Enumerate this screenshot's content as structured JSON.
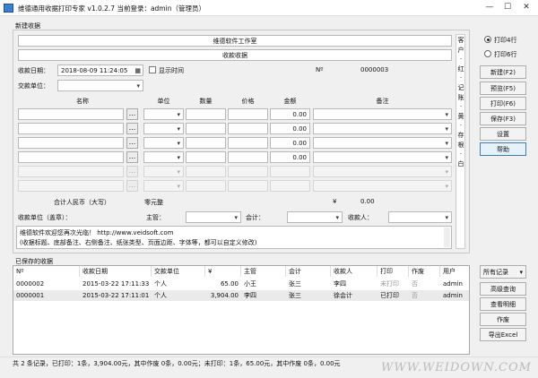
{
  "window": {
    "title": "维德通用收据打印专家 v1.0.2.7    当前登录：admin（管理员）",
    "min": "—",
    "max": "☐",
    "close": "✕"
  },
  "new_receipt": {
    "section_title": "新建收据",
    "company": "维德软件工作室",
    "doc_title": "收款收据",
    "date_label": "收款日期：",
    "date_value": "2018-08-09 11:24:05",
    "show_time_label": "显示时间",
    "no_label": "Nº",
    "no_value": "0000003",
    "payer_label": "交款单位：",
    "columns": {
      "name": "名称",
      "unit": "单位",
      "qty": "数量",
      "price": "价格",
      "amount": "金额",
      "note": "备注"
    },
    "rows": [
      {
        "amount": "0.00",
        "enabled": true
      },
      {
        "amount": "0.00",
        "enabled": true
      },
      {
        "amount": "0.00",
        "enabled": true
      },
      {
        "amount": "0.00",
        "enabled": true
      },
      {
        "amount": "",
        "enabled": false
      },
      {
        "amount": "",
        "enabled": false
      }
    ],
    "total_label": "合计人民币（大写）",
    "total_upper": "零元整",
    "yen": "¥",
    "total_value": "0.00",
    "receiver_unit_label": "收款单位（盖章）：",
    "manager_label": "主管：",
    "accountant_label": "会计：",
    "receiver_label": "收款人：",
    "memo_line1": "维德软件欢迎您再次光临！  http://www.veidsoft.com",
    "memo_line2": "(收据标题、底部备注、右侧备注、纸张类型、页面边距、字体等，都可以自定义修改)",
    "side_note": [
      "客",
      "户",
      "·",
      "红",
      "·",
      "记",
      "账",
      "·",
      "黄",
      "·",
      "存",
      "根",
      "·",
      "白"
    ]
  },
  "print_options": {
    "row4": "打印4行",
    "row6": "打印6行",
    "selected": "row4"
  },
  "buttons": {
    "new": "新建(F2)",
    "preview": "预览(F5)",
    "print": "打印(F6)",
    "save": "保存(F3)",
    "settings": "设置",
    "help": "帮助"
  },
  "saved": {
    "section_title": "已保存的收据",
    "columns": [
      "Nº",
      "收款日期",
      "交款单位",
      "¥",
      "主管",
      "会计",
      "收款人",
      "打印",
      "作废",
      "用户"
    ],
    "rows": [
      [
        "0000002",
        "2015-03-22 17:11:33",
        "个人",
        "65.00",
        "小王",
        "张三",
        "李四",
        "未打印",
        "否",
        "admin"
      ],
      [
        "0000001",
        "2015-03-22 17:11:01",
        "个人",
        "3,904.00",
        "李四",
        "张三",
        "徐会计",
        "已打印",
        "否",
        "admin"
      ]
    ]
  },
  "side_buttons": {
    "filter": "所有记录",
    "advanced": "高级查询",
    "details": "查看明细",
    "void": "作废",
    "export": "导出Excel"
  },
  "status": "共 2 条记录，已打印：1条，3,904.00元，其中作废 0条，0.00元；未打印：1条，65.00元，其中作废 0条，0.00元",
  "watermark": "WWW.WEIDOWN.COM"
}
